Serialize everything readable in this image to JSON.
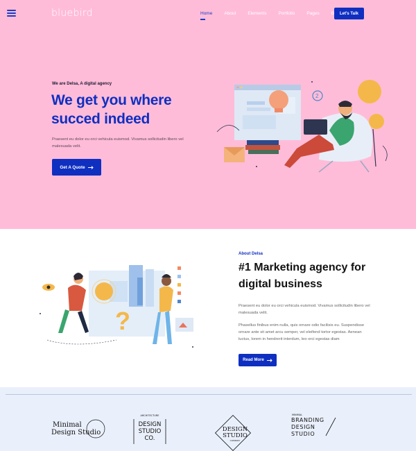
{
  "nav": {
    "logo": "bluebird",
    "items": [
      "Home",
      "About",
      "Elements",
      "Portfolio",
      "Pages",
      "Blog"
    ],
    "active": "Home",
    "cta": "Let's Talk"
  },
  "hero": {
    "tag": "We are Delsa, A digital agency",
    "title": "We get you where succed indeed",
    "text": "Praesent eu dolor eu orci vehicula euismod. Vivamus sollicitudin libero vel malesuada velit.",
    "button": "Get A Quote"
  },
  "about": {
    "tag": "About Delsa",
    "title": "#1 Marketing agency for digital business",
    "p1": "Praesent eu dolor eu orci vehicula euismod. Vivamus sollicitudin libero vel malesuada velit.",
    "p2": "Phasellus finibus enim nulla, quis ornare odio facilisis eu. Suspendisse ornare ante sit amet arcu semper, vel eleifend tortor egestas. Aenean luctus, lorem in hendrerit interdum, leo orci egestas diam",
    "button": "Read More"
  },
  "clients": {
    "logo1": {
      "line1": "Minimal",
      "line2": "Design Studio"
    },
    "logo2": {
      "top": "ARCHITECTURE",
      "line1": "DESIGN",
      "line2": "STUDIO",
      "line3": "CO."
    },
    "logo3": {
      "line1": "DESIGN",
      "line2": "STUDIO",
      "sub": "COMPANY"
    },
    "logo4": {
      "top": "MINIMAL",
      "line1": "BRANDING",
      "line2": "DESIGN",
      "line3": "STUDIO"
    }
  },
  "colors": {
    "hero_bg": "#ffbcd9",
    "brand_blue": "#0f2fc0",
    "clients_bg": "#eaf0fb"
  },
  "icons": [
    "hamburger-icon",
    "arrow-right-icon"
  ]
}
